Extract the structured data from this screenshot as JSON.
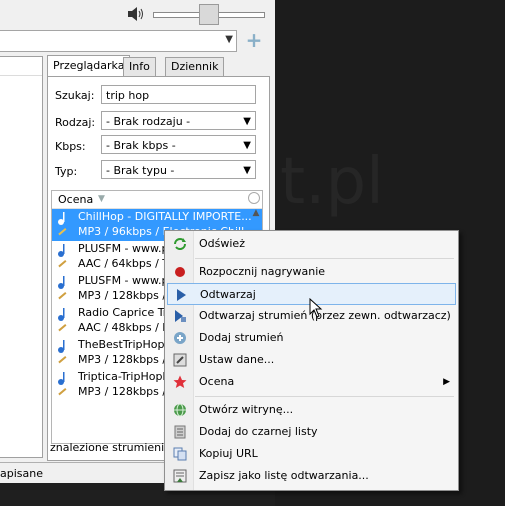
{
  "tabs": [
    "Przeglądarka",
    "Info",
    "Dziennik"
  ],
  "search": {
    "label": "Szukaj:",
    "value": "trip hop"
  },
  "genre": {
    "label": "Rodzaj:",
    "value": "- Brak rodzaju -"
  },
  "kbps": {
    "label": "Kbps:",
    "value": "- Brak kbps -"
  },
  "type": {
    "label": "Typ:",
    "value": "- Brak typu -"
  },
  "list_header": "Ocena",
  "stations": [
    {
      "l1": "ChillHop - DIGITALLY IMPORTE...",
      "l2": "MP3 / 96kbps / Electronic Chill"
    },
    {
      "l1": "PLUSFM - www.pl",
      "l2": "AAC / 64kbps / Tr"
    },
    {
      "l1": "PLUSFM - www.pl",
      "l2": "MP3 / 128kbps / E"
    },
    {
      "l1": "Radio Caprice Trip",
      "l2": "AAC / 48kbps / Mu"
    },
    {
      "l1": "TheBestTripHopRa",
      "l2": "MP3 / 128kbps / T"
    },
    {
      "l1": "Triptica-TripHopRa",
      "l2": "MP3 / 128kbps / tr"
    }
  ],
  "found_text": "znalezione strumienie - 6",
  "status_text": "apisane",
  "menu": {
    "refresh": "Odśwież",
    "record": "Rozpocznij nagrywanie",
    "play": "Odtwarzaj",
    "play_external": "Odtwarzaj strumień (przez zewn. odtwarzacz)",
    "add_stream": "Dodaj strumień",
    "set_default": "Ustaw dane...",
    "rating": "Ocena",
    "open_site": "Otwórz witrynę...",
    "blacklist": "Dodaj do czarnej listy",
    "copy_url": "Kopiuj URL",
    "save_playlist": "Zapisz jako listę odtwarzania..."
  },
  "colors": {
    "selection": "#3399ff",
    "highlight": "#e5f0fb",
    "record": "#c81e1e"
  }
}
